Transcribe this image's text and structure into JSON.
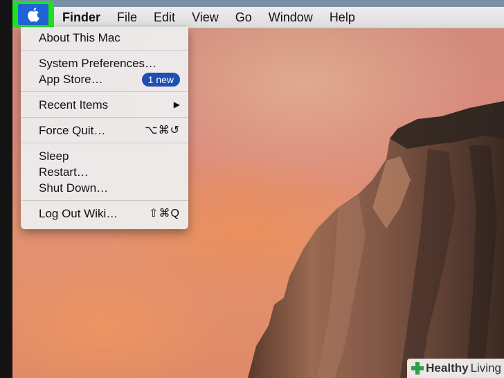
{
  "menubar": {
    "apple_icon": "apple-logo-icon",
    "items": [
      {
        "label": "Finder"
      },
      {
        "label": "File"
      },
      {
        "label": "Edit"
      },
      {
        "label": "View"
      },
      {
        "label": "Go"
      },
      {
        "label": "Window"
      },
      {
        "label": "Help"
      }
    ]
  },
  "apple_menu": {
    "about": "About This Mac",
    "system_preferences": "System Preferences…",
    "app_store": "App Store…",
    "app_store_badge": "1 new",
    "recent_items": "Recent Items",
    "force_quit": "Force Quit…",
    "force_quit_shortcut": "⌥⌘↺",
    "sleep": "Sleep",
    "restart": "Restart…",
    "shut_down": "Shut Down…",
    "log_out": "Log Out Wiki…",
    "log_out_shortcut": "⇧⌘Q"
  },
  "watermark": {
    "brand_bold": "Healthy",
    "brand_rest": "Living"
  },
  "colors": {
    "highlight": "#1fe21f",
    "badge": "#1f4fb4",
    "apple_selected": "#1f63d6"
  }
}
